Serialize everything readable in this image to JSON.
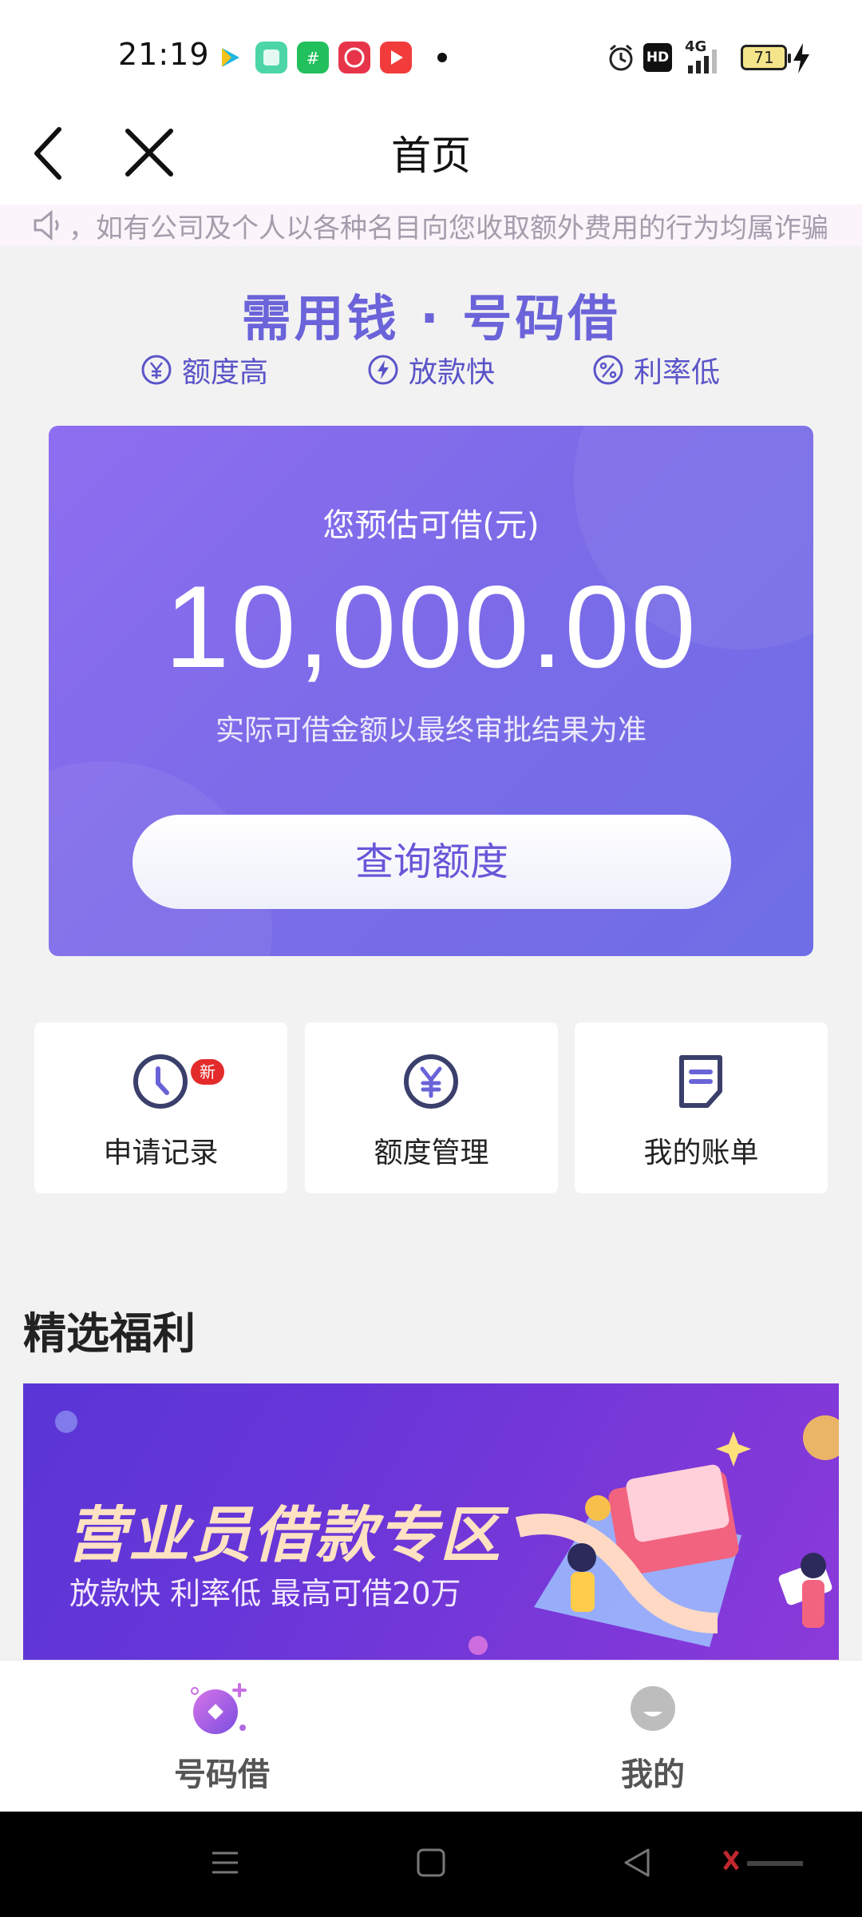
{
  "status_bar": {
    "time": "21:19",
    "battery": "71",
    "network": "4G",
    "hd": "HD"
  },
  "nav": {
    "title": "首页",
    "back_icon": "chevron-left-icon",
    "close_icon": "close-icon"
  },
  "notice": {
    "text": "，如有公司及个人以各种名目向您收取额外费用的行为均属诈骗"
  },
  "hero": {
    "slogan": "需用钱 · 号码借",
    "features": [
      {
        "icon": "yuan-circle-icon",
        "label": "额度高"
      },
      {
        "icon": "lightning-circle-icon",
        "label": "放款快"
      },
      {
        "icon": "percent-circle-icon",
        "label": "利率低"
      }
    ]
  },
  "quota_card": {
    "label": "您预估可借(元)",
    "amount": "10,000.00",
    "note": "实际可借金额以最终审批结果为准",
    "button": "查询额度"
  },
  "quick_actions": [
    {
      "icon": "clock-icon",
      "label": "申请记录",
      "badge": "新"
    },
    {
      "icon": "yuan-icon",
      "label": "额度管理"
    },
    {
      "icon": "bill-icon",
      "label": "我的账单"
    }
  ],
  "welfare": {
    "title": "精选福利",
    "banner_headline": "营业员借款专区",
    "banner_sub": "放款快 利率低 最高可借20万"
  },
  "tabs": [
    {
      "label": "号码借",
      "active": true,
      "color": "#555555"
    },
    {
      "label": "我的",
      "active": false,
      "color": "#555555"
    }
  ],
  "colors": {
    "accent": "#6b63d9",
    "card_start": "#8e6ef0",
    "card_end": "#6f6ee6",
    "badge": "#e32b2b"
  }
}
